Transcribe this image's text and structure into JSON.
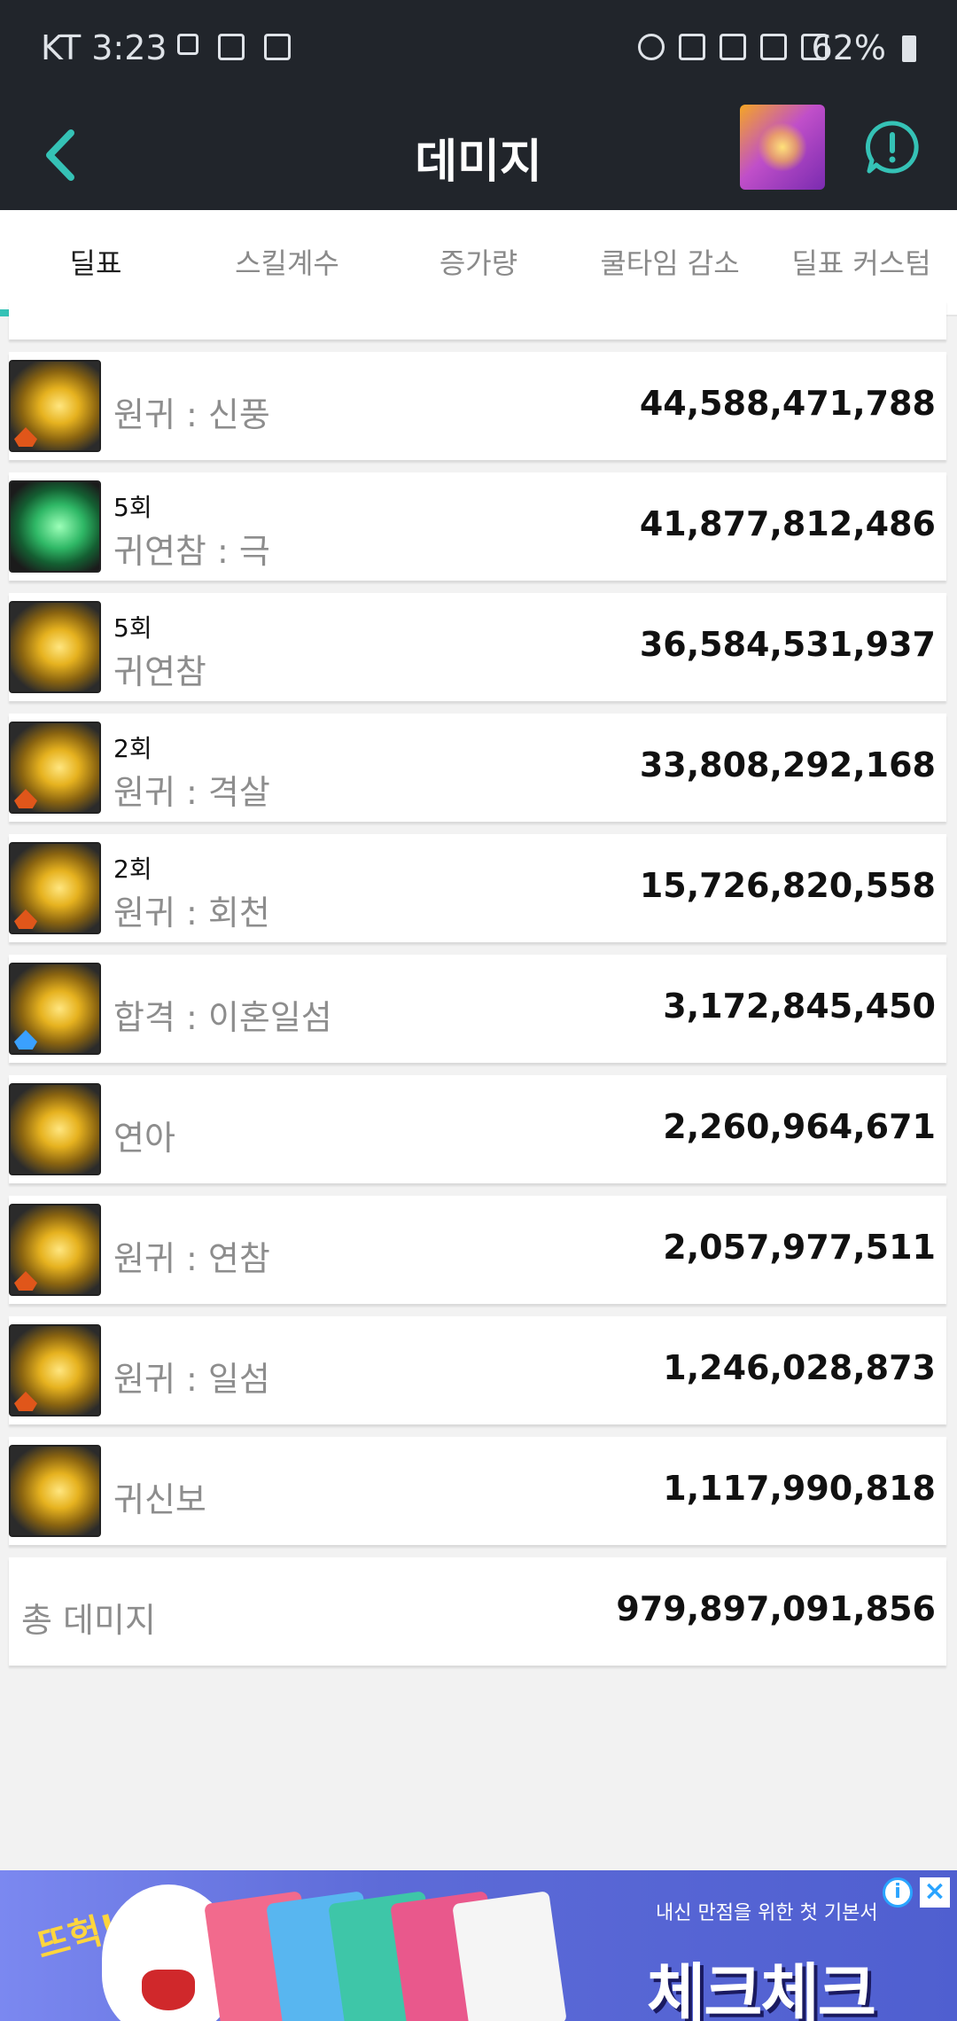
{
  "status": {
    "carrier_time": "KT 3:23",
    "battery": "62%"
  },
  "header": {
    "title": "데미지"
  },
  "tabs": [
    {
      "label": "딜표"
    },
    {
      "label": "스킬계수"
    },
    {
      "label": "증가량"
    },
    {
      "label": "쿨타임 감소"
    },
    {
      "label": "딜표 커스텀"
    }
  ],
  "skills": [
    {
      "count": "",
      "name": "원귀 : 신풍",
      "value": "44,588,471,788"
    },
    {
      "count": "5회",
      "name": "귀연참 : 극",
      "value": "41,877,812,486"
    },
    {
      "count": "5회",
      "name": "귀연참",
      "value": "36,584,531,937"
    },
    {
      "count": "2회",
      "name": "원귀 : 격살",
      "value": "33,808,292,168"
    },
    {
      "count": "2회",
      "name": "원귀 : 회천",
      "value": "15,726,820,558"
    },
    {
      "count": "",
      "name": "합격 : 이혼일섬",
      "value": "3,172,845,450"
    },
    {
      "count": "",
      "name": "연아",
      "value": "2,260,964,671"
    },
    {
      "count": "",
      "name": "원귀 : 연참",
      "value": "2,057,977,511"
    },
    {
      "count": "",
      "name": "원귀 : 일섬",
      "value": "1,246,028,873"
    },
    {
      "count": "",
      "name": "귀신보",
      "value": "1,117,990,818"
    }
  ],
  "total": {
    "label": "총 데미지",
    "value": "979,897,091,856"
  },
  "ad": {
    "exclaim": "뜨헉!!",
    "tagline": "내신 만점을 위한 첫 기본서",
    "brand": "체크체크"
  }
}
